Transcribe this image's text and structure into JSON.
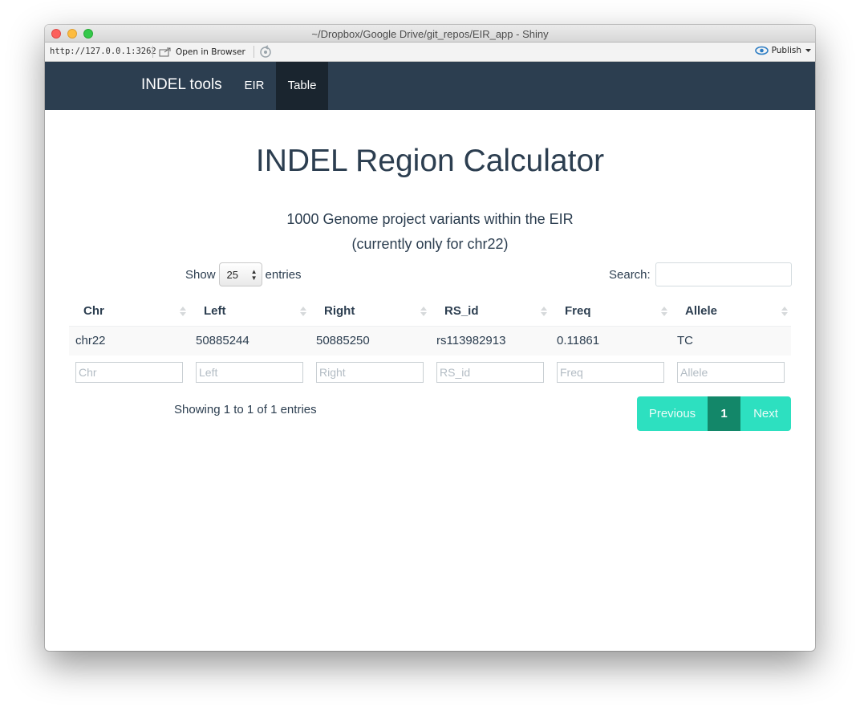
{
  "window": {
    "title": "~/Dropbox/Google Drive/git_repos/EIR_app - Shiny"
  },
  "toolbar": {
    "url": "http://127.0.0.1:3262",
    "open_in_browser": "Open in Browser",
    "publish": "Publish",
    "icons": [
      "open-in-browser-icon",
      "refresh-icon",
      "publish-icon",
      "dropdown-caret-icon"
    ]
  },
  "navbar": {
    "brand": "INDEL tools",
    "tabs": [
      {
        "label": "EIR",
        "active": false
      },
      {
        "label": "Table",
        "active": true
      }
    ],
    "colors": {
      "bg": "#2c3e50",
      "active_bg": "#1a252f"
    }
  },
  "main": {
    "title": "INDEL Region Calculator",
    "subtitle_line1": "1000 Genome project variants within the EIR",
    "subtitle_line2": "(currently only for chr22)"
  },
  "table_controls": {
    "show_label": "Show",
    "entries_value": "25",
    "entries_label": "entries",
    "search_label": "Search:",
    "search_value": ""
  },
  "table": {
    "columns": [
      "Chr",
      "Left",
      "Right",
      "RS_id",
      "Freq",
      "Allele"
    ],
    "rows": [
      [
        "chr22",
        "50885244",
        "50885250",
        "rs113982913",
        "0.11861",
        "TC"
      ]
    ],
    "filter_placeholders": [
      "Chr",
      "Left",
      "Right",
      "RS_id",
      "Freq",
      "Allele"
    ]
  },
  "footer": {
    "info": "Showing 1 to 1 of 1 entries",
    "pagination": {
      "previous": "Previous",
      "current_page": "1",
      "next": "Next"
    },
    "colors": {
      "pager": "#2de0c0",
      "pager_active": "#138769"
    }
  }
}
